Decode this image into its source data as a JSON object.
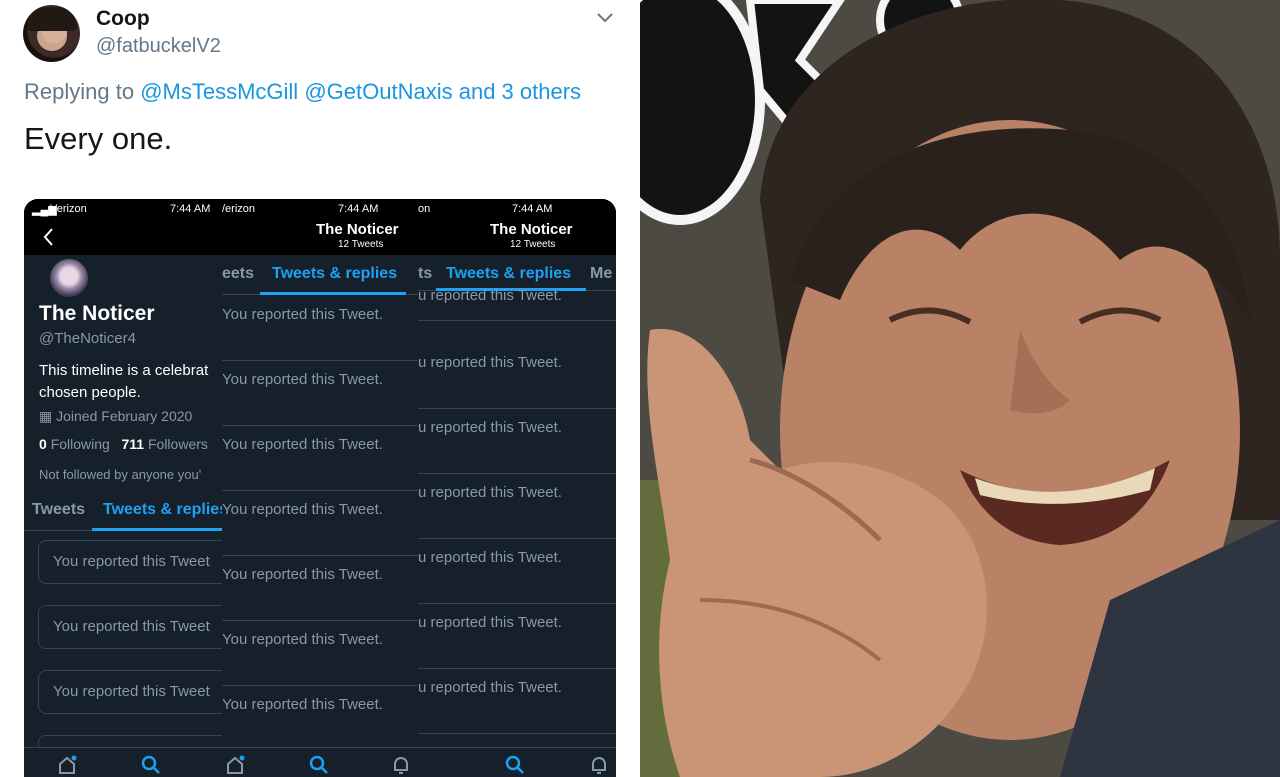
{
  "tweet": {
    "display_name": "Coop",
    "handle": "@fatbuckelV2",
    "replying_prefix": "Replying to",
    "mention_1": "@MsTessMcGill",
    "mention_2": "@GetOutNaxis",
    "others": "and 3 others",
    "text": "Every one."
  },
  "screenshot": {
    "carrier": "Verizon",
    "carrier_2": "/erizon",
    "carrier_3": "on",
    "time": "7:44 AM",
    "profile": {
      "name": "The Noticer",
      "handle": "@TheNoticer4",
      "bio_line1": "This timeline is a celebrat",
      "bio_line2": "chosen people.",
      "joined": "Joined February 2020",
      "following_count": "0",
      "following_label": "Following",
      "followers_count": "711",
      "followers_label": "Followers",
      "note": "Not followed by anyone you'"
    },
    "header_title": "The Noticer",
    "header_subtitle": "12 Tweets",
    "tabs": {
      "tweets": "Tweets",
      "tweets_partial": "eets",
      "tweets_partial_2": "ts",
      "replies": "Tweets & replies",
      "replies_partial": "Tweets & replies",
      "media_partial": "Me"
    },
    "col1_rows": [
      "You reported this Tweet",
      "You reported this Tweet",
      "You reported this Tweet"
    ],
    "col2_rows": [
      "You reported this Tweet.",
      "You reported this Tweet.",
      "You reported this Tweet.",
      "You reported this Tweet.",
      "You reported this Tweet.",
      "You reported this Tweet.",
      "You reported this Tweet."
    ],
    "col3_top": "u reported this Tweet.",
    "col3_rows": [
      "u reported this Tweet.",
      "u reported this Tweet.",
      "u reported this Tweet.",
      "u reported this Tweet.",
      "u reported this Tweet.",
      "u reported this Tweet."
    ]
  },
  "colors": {
    "link": "#1b95e0",
    "dark_bg": "#15202b",
    "accent": "#1da1f2"
  }
}
